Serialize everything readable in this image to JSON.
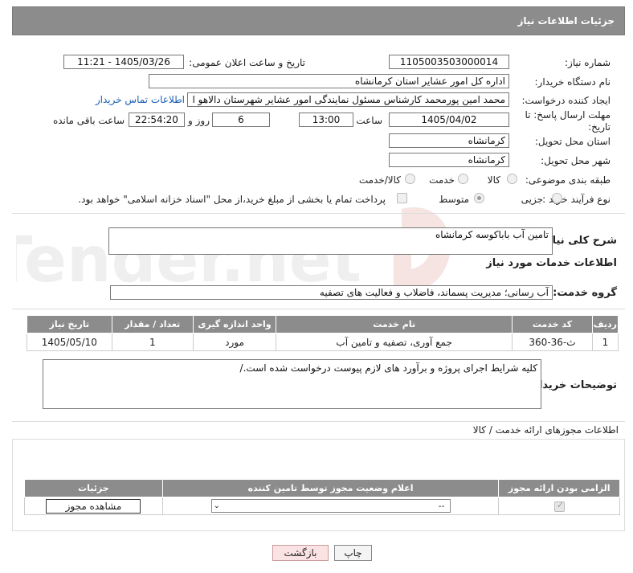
{
  "header": {
    "title": "جزئیات اطلاعات نیاز"
  },
  "watermark": {
    "text": "AriaTender.net"
  },
  "fields": {
    "need_number_label": "شماره نیاز:",
    "need_number": "1105003503000014",
    "announce_label": "تاریخ و ساعت اعلان عمومی:",
    "announce_value": "1405/03/26 - 11:21",
    "buyer_org_label": "نام دستگاه خریدار:",
    "buyer_org": "اداره کل امور عشایر استان کرمانشاه",
    "creator_label": "ایجاد کننده درخواست:",
    "creator": "محمد امین پورمحمد کارشناس مسئول نمایندگی امور عشایر شهرستان دالاهو ا",
    "contact_link": "اطلاعات تماس خریدار",
    "deadline_label": "مهلت ارسال پاسخ: تا تاریخ:",
    "deadline_date": "1405/04/02",
    "time_label": "ساعت",
    "deadline_time": "13:00",
    "days_value": "6",
    "days_label": "روز و",
    "remaining_time": "22:54:20",
    "remaining_label": "ساعت باقی مانده",
    "province_label": "استان محل تحویل:",
    "province": "کرمانشاه",
    "city_label": "شهر محل تحویل:",
    "city": "کرمانشاه",
    "category_label": "طبقه بندی موضوعی:",
    "category_options": [
      "کالا",
      "خدمت",
      "کالا/خدمت"
    ],
    "process_label": "نوع فرآیند خرید :",
    "process_options": [
      "جزیی",
      "متوسط"
    ],
    "payment_note": "پرداخت تمام یا بخشی از مبلغ خرید،از محل \"اسناد خزانه اسلامی\" خواهد بود."
  },
  "summary": {
    "label": "شرح کلی نیاز:",
    "value": "تامین آب باباکوسه کرمانشاه"
  },
  "services_info": {
    "title": "اطلاعات خدمات مورد نیاز",
    "group_label": "گروه خدمت:",
    "group_value": "آب رسانی؛ مدیریت پسماند، فاضلاب و فعالیت های تصفیه"
  },
  "services_table": {
    "headers": [
      "ردیف",
      "کد خدمت",
      "نام خدمت",
      "واحد اندازه گیری",
      "تعداد / مقدار",
      "تاریخ نیاز"
    ],
    "rows": [
      [
        "1",
        "ث-36-360",
        "جمع آوری، تصفیه و تامین آب",
        "مورد",
        "1",
        "1405/05/10"
      ]
    ]
  },
  "buyer_notes": {
    "label": "توضیحات خریدار:",
    "value": "کلیه شرایط اجرای پروژه و برآورد های لازم پیوست درخواست شده است./"
  },
  "permits": {
    "title": "اطلاعات مجوزهای ارائه خدمت / کالا",
    "headers": [
      "الزامی بودن ارائه مجوز",
      "اعلام وضعیت مجوز توسط تامین کننده",
      "جزئیات"
    ],
    "select_value": "--",
    "view_button": "مشاهده مجوز"
  },
  "buttons": {
    "print": "چاپ",
    "back": "بازگشت"
  }
}
